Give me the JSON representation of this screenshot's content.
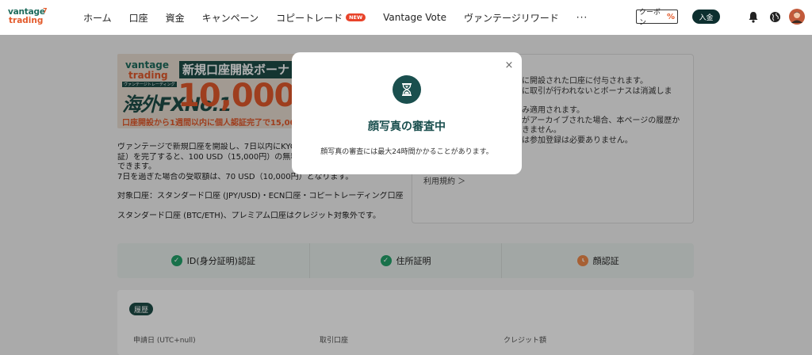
{
  "header": {
    "logo": {
      "line1": "vantage",
      "line2": "trading",
      "mark": "7"
    },
    "nav": [
      {
        "label": "ホーム"
      },
      {
        "label": "口座"
      },
      {
        "label": "資金"
      },
      {
        "label": "キャンペーン"
      },
      {
        "label": "コピートレード",
        "badge": "NEW"
      },
      {
        "label": "Vantage Vote"
      },
      {
        "label": "ヴァンテージリワード"
      }
    ],
    "more": "···",
    "coupon": {
      "label": "クーポン",
      "symbol": "%"
    },
    "deposit": "入金",
    "icons": [
      "bell-icon",
      "globe-icon",
      "avatar"
    ]
  },
  "banner": {
    "logo1": "vantage",
    "logo2": "trading",
    "logo_sub": "ヴァンテージトレーディング",
    "fx_label": "海外FXNo.1",
    "title": "新規口座開設ボーナ",
    "amount": "10,000",
    "bottom": "口座開設から1週間以内に個人認証完了で15,00"
  },
  "description": {
    "lines": [
      "ヴァンテージで新規口座を開設し、7日以内にKYC",
      "証）を完了すると、100 USD（15,000円）の無料",
      "できます。",
      "7日を過ぎた場合の受取額は、70 USD（10,000円）となります。",
      "",
      "対象口座：スタンダード口座 (JPY/USD)・ECN口座・コピートレーディング口座",
      "",
      "スタンダード口座 (BTC/ETH)、プレミアム口座はクレジット対象外です。"
    ]
  },
  "terms": {
    "lines": [
      "に開設された口座に付与されます。",
      "に取引が行われないとボーナスは消滅しま",
      "",
      "み適用されます。",
      "がアーカイブされた場合、本ページの履歴か",
      "きません。",
      "は参加登録は必要ありません。"
    ],
    "link": "利用規約 ＞"
  },
  "verification": [
    {
      "label": "ID(身分証明)認証",
      "status": "done"
    },
    {
      "label": "住所証明",
      "status": "done"
    },
    {
      "label": "顔認証",
      "status": "pending"
    }
  ],
  "history": {
    "badge": "履歴",
    "columns": [
      "申請日 (UTC+null)",
      "取引口座",
      "クレジット額"
    ]
  },
  "modal": {
    "title": "顔写真の審査中",
    "message": "顔写真の審査には最大24時間かかることがあります。",
    "icon": "hourglass-icon",
    "close": "×"
  },
  "colors": {
    "brand_dark": "#1a4f4e",
    "brand_orange": "#e35a2b",
    "success": "#23a36b",
    "pending": "#f08a4b",
    "new_badge": "#e8432a"
  }
}
